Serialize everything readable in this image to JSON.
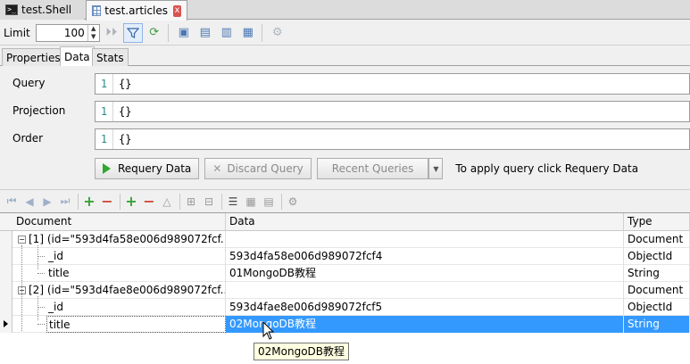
{
  "tabs": [
    {
      "label": "test.Shell",
      "icon": "shell-icon"
    },
    {
      "label": "test.articles",
      "icon": "table-icon",
      "close": "x"
    }
  ],
  "toolbar": {
    "limit_label": "Limit",
    "limit_value": "100"
  },
  "sub_tabs": [
    "Properties",
    "Data",
    "Stats"
  ],
  "query": {
    "rows": [
      {
        "label": "Query",
        "line": "1",
        "value": "{}"
      },
      {
        "label": "Projection",
        "line": "1",
        "value": "{}"
      },
      {
        "label": "Order",
        "line": "1",
        "value": "{}"
      }
    ],
    "requery_label": "Requery Data",
    "discard_label": "Discard Query",
    "recent_label": "Recent Queries",
    "hint": "To apply query click Requery Data"
  },
  "grid": {
    "columns": [
      "Document",
      "Data",
      "Type"
    ],
    "rows": [
      {
        "doc": "[1] (id=\"593d4fa58e006d989072fcf...",
        "data": "",
        "type": "Document"
      },
      {
        "doc": "_id",
        "data": "593d4fa58e006d989072fcf4",
        "type": "ObjectId"
      },
      {
        "doc": "title",
        "data": "01MongoDB教程",
        "type": "String"
      },
      {
        "doc": "[2] (id=\"593d4fae8e006d989072fcf...",
        "data": "",
        "type": "Document"
      },
      {
        "doc": "_id",
        "data": "593d4fae8e006d989072fcf5",
        "type": "ObjectId"
      },
      {
        "doc": "title",
        "data": "02MongoDB教程",
        "type": "String"
      }
    ]
  },
  "tooltip": "02MongoDB教程"
}
